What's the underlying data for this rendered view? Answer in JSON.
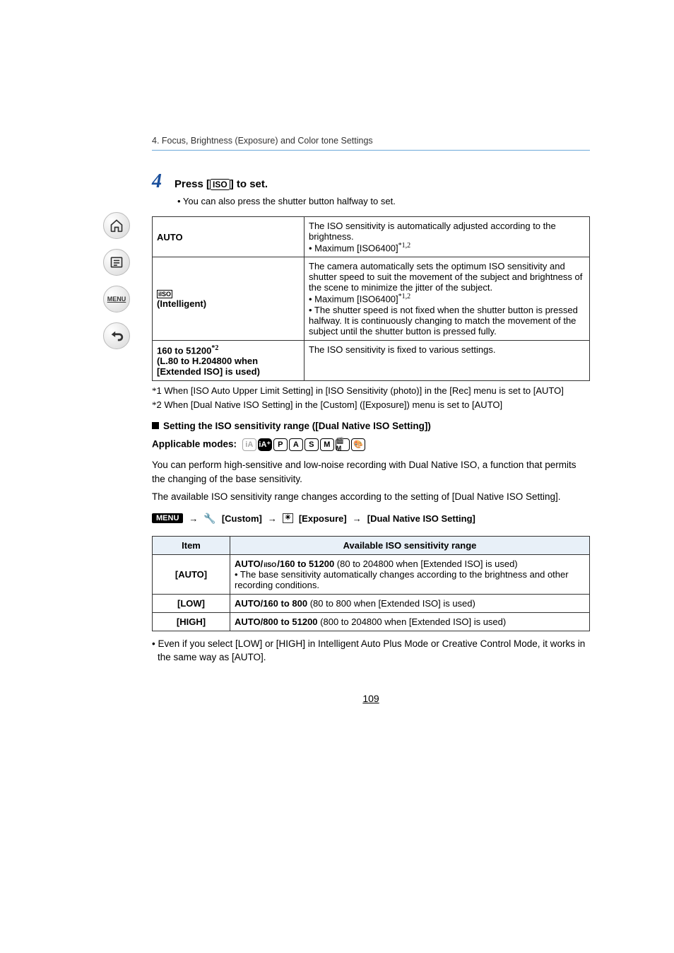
{
  "breadcrumb": "4. Focus, Brightness (Exposure) and Color tone Settings",
  "step": {
    "num": "4",
    "text_pre": "Press [",
    "iso_label": "ISO",
    "text_post": "] to set."
  },
  "sub_bullet": "• You can also press the shutter button halfway to set.",
  "table1": {
    "rows": [
      {
        "left": "AUTO",
        "right": "The ISO sensitivity is automatically adjusted according to the brightness.\n• Maximum [ISO6400]*1,2"
      },
      {
        "left_icon": "iISO",
        "left": "(Intelligent)",
        "right": "The camera automatically sets the optimum ISO sensitivity and shutter speed to suit the movement of the subject and brightness of the scene to minimize the jitter of the subject.\n• Maximum [ISO6400]*1,2\n• The shutter speed is not fixed when the shutter button is pressed halfway. It is continuously changing to match the movement of the subject until the shutter button is pressed fully."
      },
      {
        "left": "160 to 51200*2\n(L.80 to H.204800 when [Extended ISO] is used)",
        "right": "The ISO sensitivity is fixed to various settings."
      }
    ]
  },
  "footnotes": [
    "*1 When [ISO Auto Upper Limit Setting] in [ISO Sensitivity (photo)] in the [Rec] menu is set to [AUTO]",
    "*2 When [Dual Native ISO Setting] in the [Custom] ([Exposure]) menu is set to [AUTO]"
  ],
  "section_header": "Setting the ISO sensitivity range ([Dual Native ISO Setting])",
  "applicable_label": "Applicable modes:",
  "body_paragraphs": [
    "You can perform high-sensitive and low-noise recording with Dual Native ISO, a function that permits the changing of the base sensitivity.",
    "The available ISO sensitivity range changes according to the setting of [Dual Native ISO Setting]."
  ],
  "menu_path": {
    "menu": "MENU",
    "custom": "[Custom]",
    "exposure": "[Exposure]",
    "setting": "[Dual Native ISO Setting]"
  },
  "table2": {
    "headers": [
      "Item",
      "Available ISO sensitivity range"
    ],
    "rows": [
      {
        "item": "[AUTO]",
        "range_bold": "AUTO/iISO/160 to 51200",
        "range_rest": " (80 to 204800 when [Extended ISO] is used)",
        "bullet": "• The base sensitivity automatically changes according to the brightness and other recording conditions."
      },
      {
        "item": "[LOW]",
        "range_bold": "AUTO/160 to 800",
        "range_rest": " (80 to 800 when [Extended ISO] is used)"
      },
      {
        "item": "[HIGH]",
        "range_bold": "AUTO/800 to 51200",
        "range_rest": " (800 to 204800 when [Extended ISO] is used)"
      }
    ]
  },
  "final_note": "• Even if you select [LOW] or [HIGH] in Intelligent Auto Plus Mode or Creative Control Mode, it works in the same way as [AUTO].",
  "page_number": "109",
  "modes": [
    {
      "label": "iA",
      "faded": true
    },
    {
      "label": "iA+",
      "faded": false,
      "ia": true
    },
    {
      "label": "P",
      "faded": false
    },
    {
      "label": "A",
      "faded": false
    },
    {
      "label": "S",
      "faded": false
    },
    {
      "label": "M",
      "faded": false
    },
    {
      "label": "🎬M",
      "faded": false
    },
    {
      "label": "🎨",
      "faded": false
    }
  ]
}
